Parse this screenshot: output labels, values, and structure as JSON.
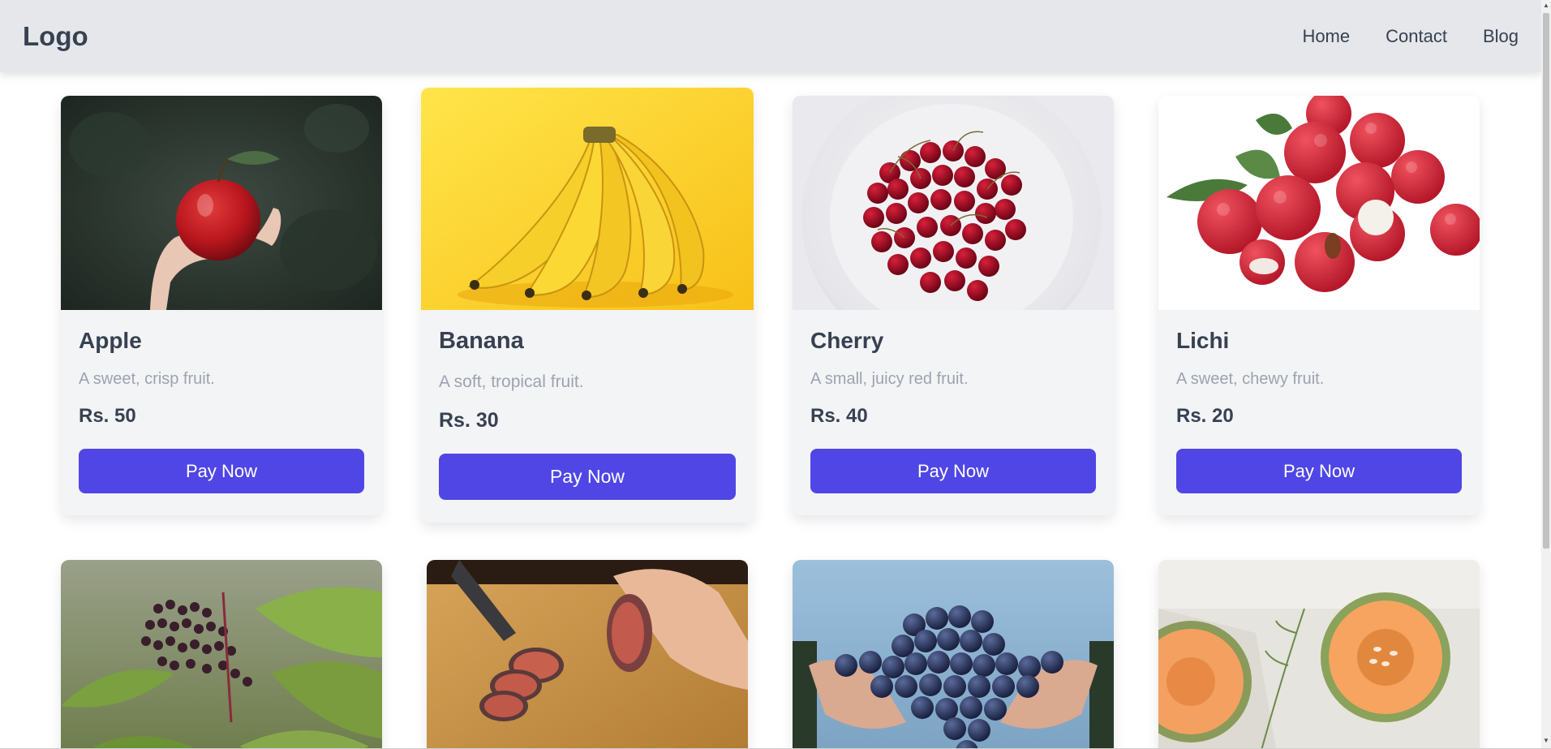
{
  "nav": {
    "logo": "Logo",
    "links": [
      "Home",
      "Contact",
      "Blog"
    ]
  },
  "products": [
    {
      "name": "Apple",
      "description": "A sweet, crisp fruit.",
      "price": "Rs. 50",
      "button": "Pay Now"
    },
    {
      "name": "Banana",
      "description": "A soft, tropical fruit.",
      "price": "Rs. 30",
      "button": "Pay Now"
    },
    {
      "name": "Cherry",
      "description": "A small, juicy red fruit.",
      "price": "Rs. 40",
      "button": "Pay Now"
    },
    {
      "name": "Lichi",
      "description": "A sweet, chewy fruit.",
      "price": "Rs. 20",
      "button": "Pay Now"
    }
  ],
  "second_row_images": [
    "elderberry",
    "fig",
    "grapes",
    "melon"
  ],
  "colors": {
    "accent": "#4f46e5",
    "navbar": "#e5e7eb",
    "card": "#f3f4f6",
    "text": "#374151",
    "muted": "#9ca3af"
  }
}
